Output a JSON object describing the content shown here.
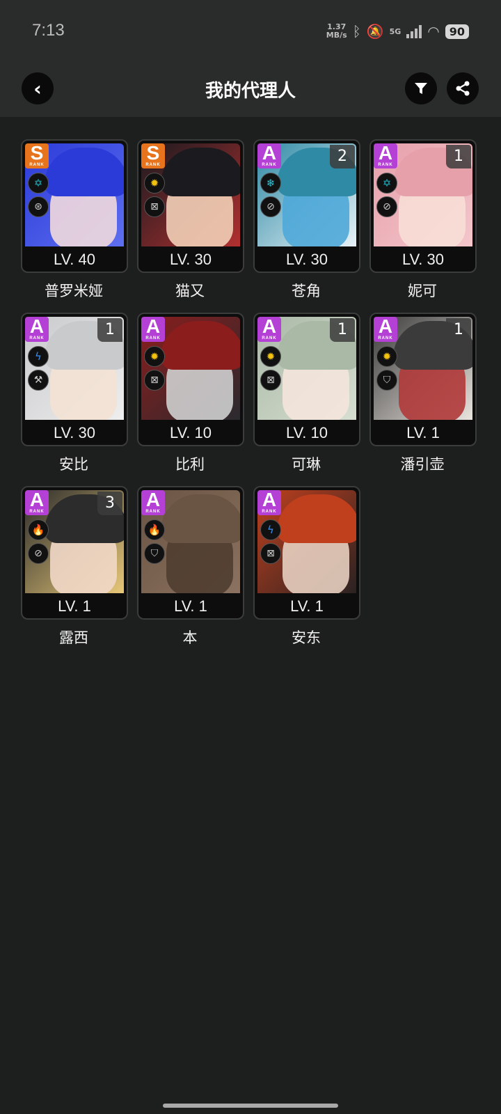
{
  "status": {
    "time": "7:13",
    "net_speed_value": "1.37",
    "net_speed_unit": "MB/s",
    "network_type": "5G",
    "battery": "90"
  },
  "header": {
    "title": "我的代理人"
  },
  "agents": [
    {
      "name": "普罗米娅",
      "level": "LV. 40",
      "rank": "S",
      "cinema": "",
      "attr": "ether",
      "role": "anomaly",
      "palette": [
        "#2b3bd8",
        "#5e6ff0",
        "#f1d9dd"
      ]
    },
    {
      "name": "猫又",
      "level": "LV. 30",
      "rank": "S",
      "cinema": "",
      "attr": "physical",
      "role": "attack",
      "palette": [
        "#1a1a1f",
        "#b23030",
        "#f2cfb7"
      ]
    },
    {
      "name": "苍角",
      "level": "LV. 30",
      "rank": "A",
      "cinema": "2",
      "attr": "ice",
      "role": "support",
      "palette": [
        "#2f8aa5",
        "#e8f2f7",
        "#4fa8d8"
      ]
    },
    {
      "name": "妮可",
      "level": "LV. 30",
      "rank": "A",
      "cinema": "1",
      "attr": "ether",
      "role": "support",
      "palette": [
        "#e6a0aa",
        "#f4c6cc",
        "#f7ded6"
      ]
    },
    {
      "name": "安比",
      "level": "LV. 30",
      "rank": "A",
      "cinema": "1",
      "attr": "electric",
      "role": "stun",
      "palette": [
        "#c9cacc",
        "#eeeeee",
        "#f3e2d4"
      ]
    },
    {
      "name": "比利",
      "level": "LV. 10",
      "rank": "A",
      "cinema": "",
      "attr": "physical",
      "role": "attack",
      "palette": [
        "#8b1d1d",
        "#2a2a2e",
        "#cfcfcf"
      ]
    },
    {
      "name": "可琳",
      "level": "LV. 10",
      "rank": "A",
      "cinema": "1",
      "attr": "physical",
      "role": "attack",
      "palette": [
        "#aab8a6",
        "#d6dfd2",
        "#f4e4dc"
      ]
    },
    {
      "name": "潘引壶",
      "level": "LV. 1",
      "rank": "A",
      "cinema": "1",
      "attr": "physical",
      "role": "defense",
      "palette": [
        "#3b3b3b",
        "#e9e4de",
        "#b03a3a"
      ]
    },
    {
      "name": "露西",
      "level": "LV. 1",
      "rank": "A",
      "cinema": "3",
      "attr": "fire",
      "role": "support",
      "palette": [
        "#2c2c2c",
        "#e8c878",
        "#f1d8c8"
      ]
    },
    {
      "name": "本",
      "level": "LV. 1",
      "rank": "A",
      "cinema": "",
      "attr": "fire",
      "role": "defense",
      "palette": [
        "#6a5443",
        "#8c7260",
        "#4f3d30"
      ]
    },
    {
      "name": "安东",
      "level": "LV. 1",
      "rank": "A",
      "cinema": "",
      "attr": "electric",
      "role": "attack",
      "palette": [
        "#c0401e",
        "#2a2222",
        "#e7cfc0"
      ]
    }
  ],
  "rank_badge_text": "RANK",
  "icons": {
    "back": "chevron-left-icon",
    "filter": "filter-icon",
    "share": "share-icon"
  },
  "attr_colors": {
    "ether": "#1fb9c9",
    "physical": "#f2c20f",
    "ice": "#2fc4d8",
    "electric": "#3b8ef5",
    "fire": "#f25a25"
  },
  "attr_glyphs": {
    "ether": "✡",
    "physical": "✹",
    "ice": "❄",
    "electric": "ϟ",
    "fire": "🔥"
  },
  "role_glyphs": {
    "anomaly": "⊛",
    "attack": "⊠",
    "support": "⊘",
    "stun": "⚒",
    "defense": "⛉"
  }
}
